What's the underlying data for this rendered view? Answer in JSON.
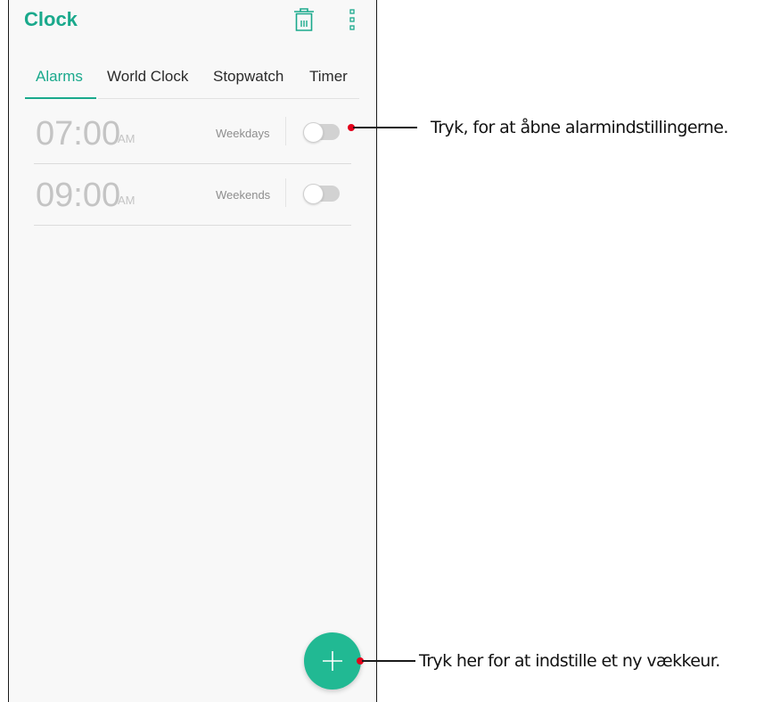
{
  "app": {
    "title": "Clock"
  },
  "toolbar": {
    "delete_icon": "trash-icon",
    "menu_icon": "more-vertical-icon"
  },
  "tabs": [
    {
      "label": "Alarms",
      "active": true
    },
    {
      "label": "World Clock",
      "active": false
    },
    {
      "label": "Stopwatch",
      "active": false
    },
    {
      "label": "Timer",
      "active": false
    }
  ],
  "alarms": [
    {
      "time": "07:00",
      "ampm": "AM",
      "repeat": "Weekdays",
      "enabled": false
    },
    {
      "time": "09:00",
      "ampm": "AM",
      "repeat": "Weekends",
      "enabled": false
    }
  ],
  "fab": {
    "icon": "plus-icon"
  },
  "callouts": [
    {
      "text": "Tryk, for at åbne alarmindstillingerne."
    },
    {
      "text": "Tryk her for at indstille et ny vækkeur."
    }
  ],
  "colors": {
    "accent": "#1aa98c",
    "fab": "#21b993",
    "callout_dot": "#e3001b"
  }
}
